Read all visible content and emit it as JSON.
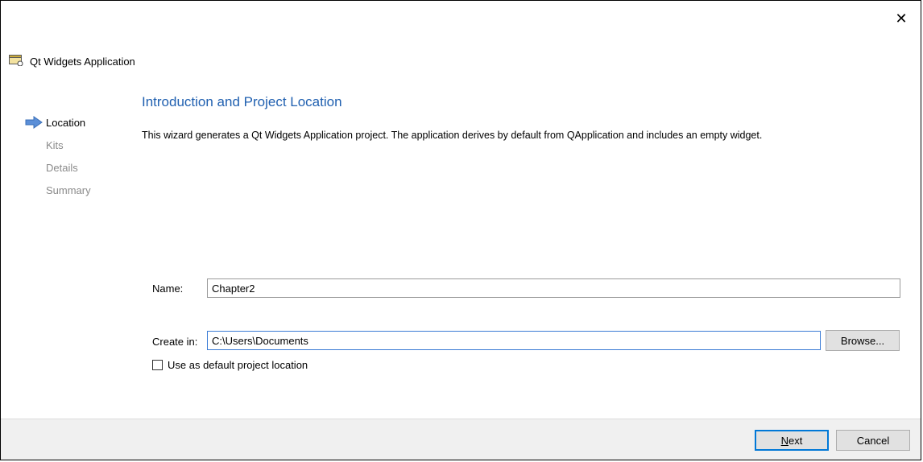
{
  "window": {
    "title": "Qt Widgets Application",
    "close_glyph": "✕"
  },
  "sidebar": {
    "items": [
      {
        "label": "Location",
        "current": true,
        "icon": "arrow-right-icon"
      },
      {
        "label": "Kits",
        "current": false
      },
      {
        "label": "Details",
        "current": false
      },
      {
        "label": "Summary",
        "current": false
      }
    ]
  },
  "page": {
    "title": "Introduction and Project Location",
    "description": "This wizard generates a Qt Widgets Application project. The application derives by default from QApplication and includes an empty widget."
  },
  "form": {
    "name_label": "Name:",
    "name_value": "Chapter2",
    "create_in_label": "Create in:",
    "create_in_value": "C:\\Users\\Documents",
    "browse_label": "Browse...",
    "default_location_label": "Use as default project location",
    "default_location_checked": false
  },
  "footer": {
    "next_mnemonic": "N",
    "next_rest": "ext",
    "cancel_label": "Cancel"
  },
  "colors": {
    "accent": "#2060b0",
    "focus": "#3a7bd5",
    "arrow": "#5b8fd8"
  }
}
